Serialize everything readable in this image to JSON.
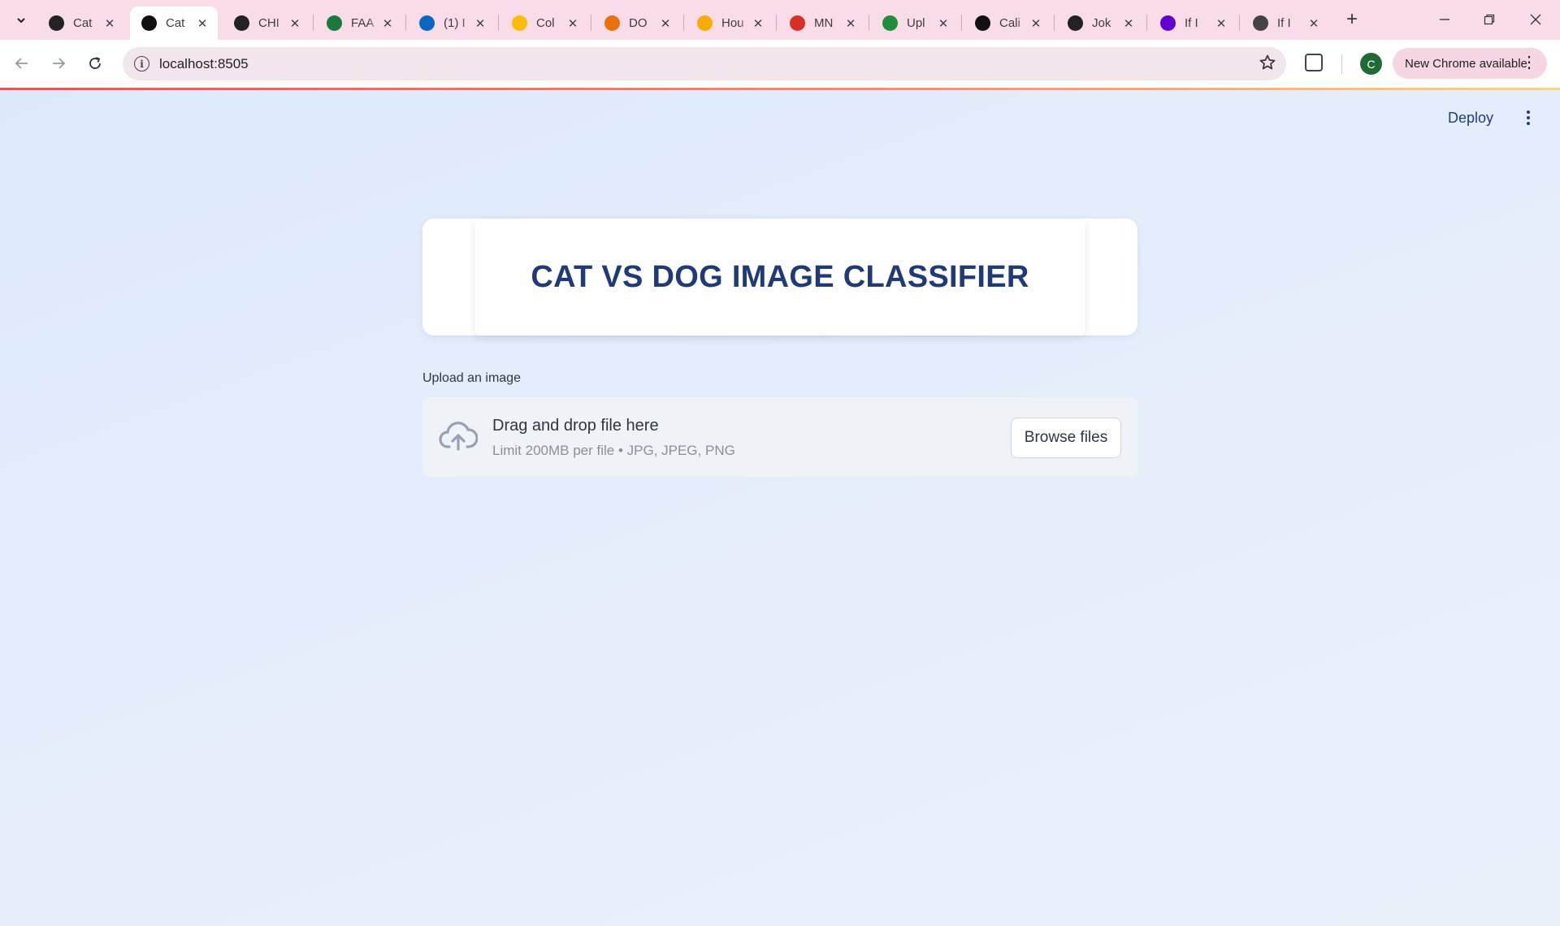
{
  "browser": {
    "tabs": [
      {
        "title": "Cat",
        "favicon": "openai-icon",
        "fav_color": "#222222"
      },
      {
        "title": "Cat",
        "favicon": "streamlit-crown-icon",
        "fav_color": "#111111",
        "active": true
      },
      {
        "title": "CHI",
        "favicon": "github-icon",
        "fav_color": "#222222"
      },
      {
        "title": "FAA",
        "favicon": "leaf-icon",
        "fav_color": "#1a7a3c"
      },
      {
        "title": "(1) I",
        "favicon": "linkedin-icon",
        "fav_color": "#0a66c2"
      },
      {
        "title": "Col",
        "favicon": "google-drive-icon",
        "fav_color": "#fbbc04"
      },
      {
        "title": "DO",
        "favicon": "colab-icon",
        "fav_color": "#e8710a"
      },
      {
        "title": "Hou",
        "favicon": "colab-icon",
        "fav_color": "#f9ab00"
      },
      {
        "title": "MN",
        "favicon": "gmail-icon",
        "fav_color": "#d93025"
      },
      {
        "title": "Upl",
        "favicon": "chat-icon",
        "fav_color": "#1e8e3e"
      },
      {
        "title": "Cali",
        "favicon": "streamlit-crown-icon",
        "fav_color": "#111111"
      },
      {
        "title": "Jok",
        "favicon": "openai-icon",
        "fav_color": "#222222"
      },
      {
        "title": "If I",
        "favicon": "yahoo-icon",
        "fav_color": "#6001d2"
      },
      {
        "title": "If I",
        "favicon": "image-icon",
        "fav_color": "#444444"
      }
    ],
    "url": "localhost:8505",
    "profile_initial": "C",
    "update_label": "New Chrome available"
  },
  "app": {
    "deploy_label": "Deploy",
    "title": "CAT VS DOG IMAGE CLASSIFIER",
    "uploader": {
      "label": "Upload an image",
      "drop_text": "Drag and drop file here",
      "limit_text": "Limit 200MB per file • JPG, JPEG, PNG",
      "browse_label": "Browse files"
    }
  }
}
